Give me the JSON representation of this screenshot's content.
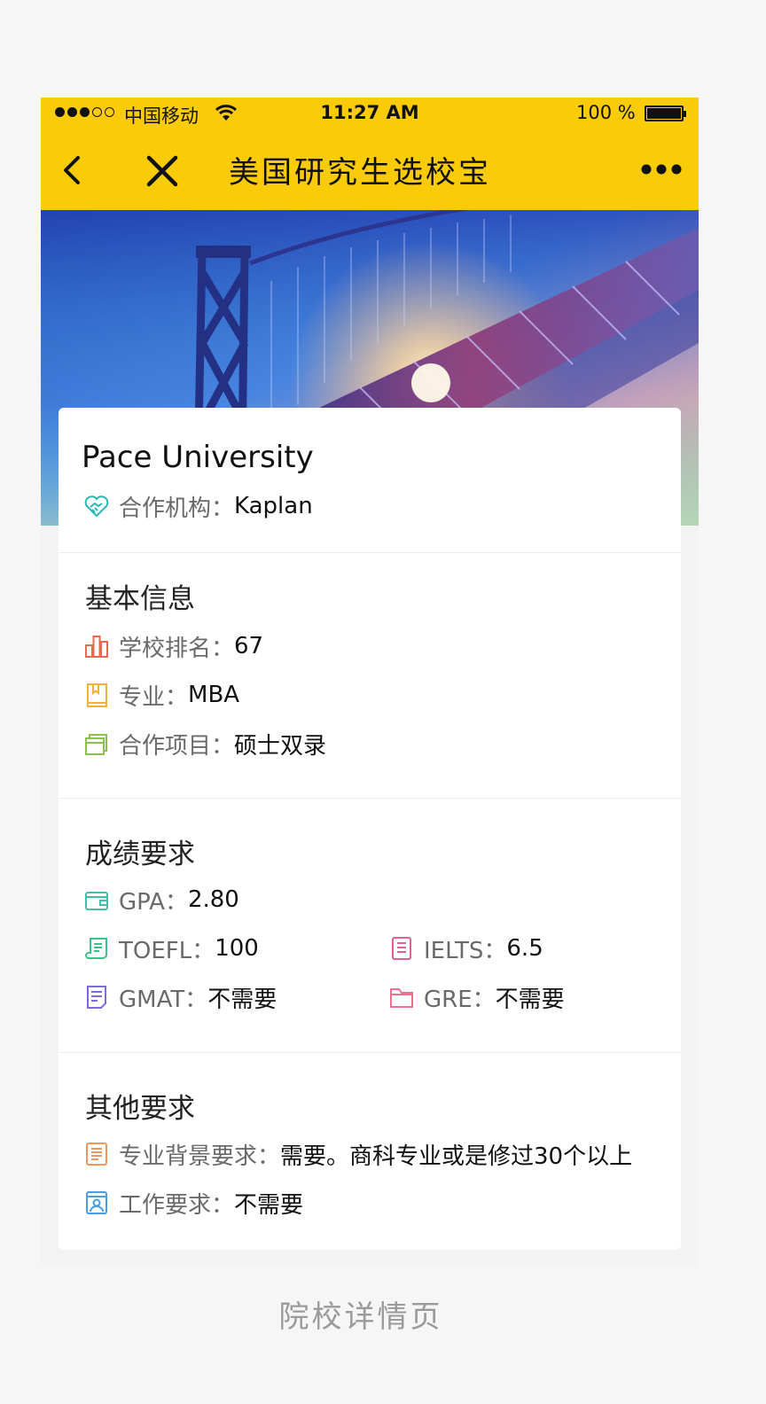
{
  "status_bar": {
    "carrier": "中国移动",
    "time": "11:27 AM",
    "battery_text": "100 %"
  },
  "nav": {
    "title": "美国研究生选校宝",
    "back_icon": "chevron-left-icon",
    "close_icon": "close-icon",
    "more_icon": "more-icon"
  },
  "school": {
    "name": "Pace University",
    "partner_label": "合作机构：",
    "partner_value": "Kaplan"
  },
  "basic_info": {
    "title": "基本信息",
    "items": [
      {
        "label": "学校排名：",
        "value": "67",
        "icon": "ranking-chart-icon",
        "color": "#e8694f"
      },
      {
        "label": "专业：",
        "value": "MBA",
        "icon": "book-icon",
        "color": "#f2b23a"
      },
      {
        "label": "合作项目：",
        "value": "硕士双录",
        "icon": "folder-stack-icon",
        "color": "#8cc152"
      }
    ]
  },
  "score_requirements": {
    "title": "成绩要求",
    "gpa": {
      "label": "GPA：",
      "value": "2.80",
      "icon": "wallet-icon",
      "color": "#3fbfa8"
    },
    "toefl": {
      "label": "TOEFL：",
      "value": "100",
      "icon": "scroll-icon",
      "color": "#3fbf8a"
    },
    "ielts": {
      "label": "IELTS：",
      "value": "6.5",
      "icon": "document-icon",
      "color": "#e4608f"
    },
    "gmat": {
      "label": "GMAT：",
      "value": "不需要",
      "icon": "notes-icon",
      "color": "#7a6ce0"
    },
    "gre": {
      "label": "GRE：",
      "value": "不需要",
      "icon": "folder-icon",
      "color": "#f07090"
    }
  },
  "other_requirements": {
    "title": "其他要求",
    "items": [
      {
        "label": "专业背景要求：",
        "value": "需要。商科专业或是修过30个以上",
        "icon": "list-doc-icon",
        "color": "#f0965a"
      },
      {
        "label": "工作要求：",
        "value": "不需要",
        "icon": "id-card-icon",
        "color": "#4a9de0"
      }
    ]
  },
  "caption": "院校详情页"
}
